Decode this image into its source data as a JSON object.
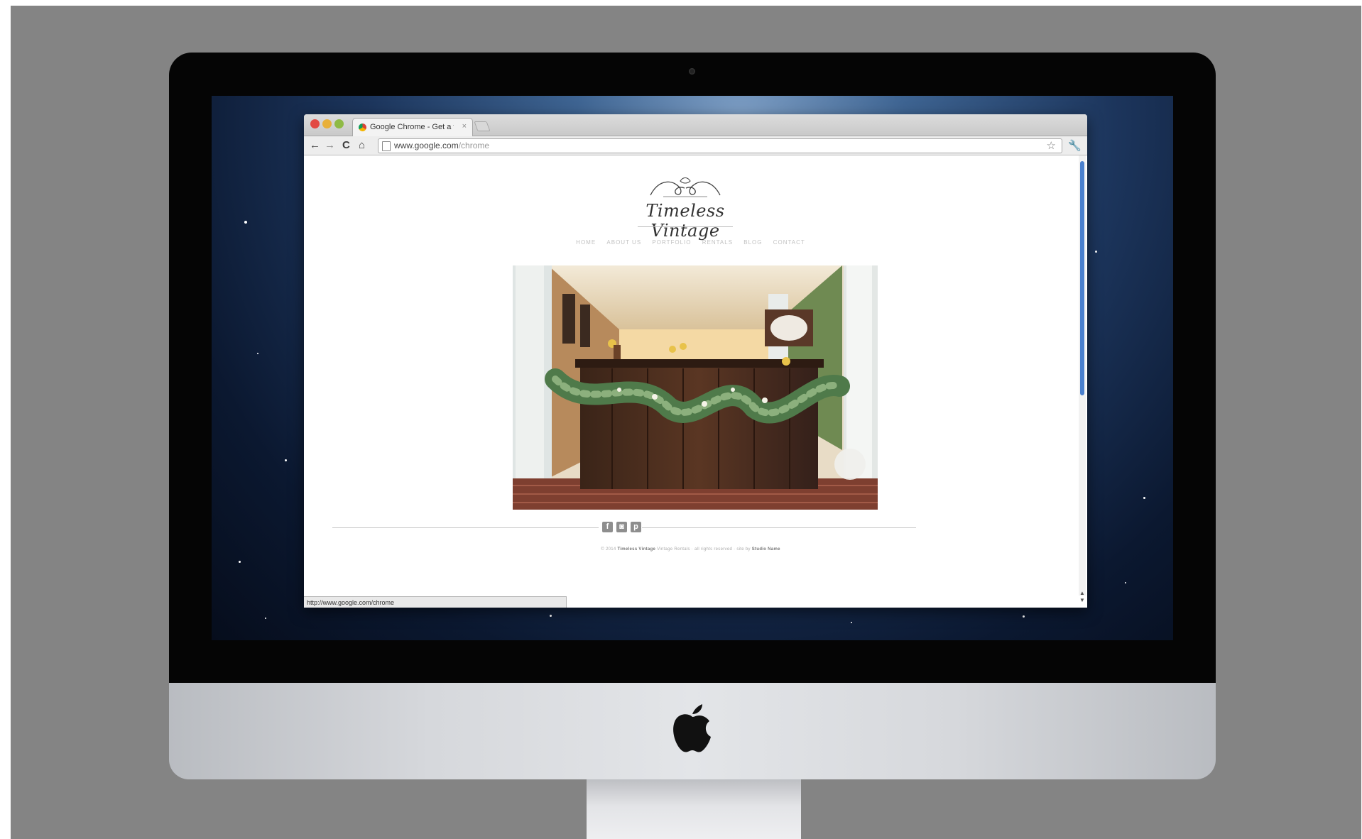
{
  "browser": {
    "tab_title": "Google Chrome - Get a fast...",
    "tab_close": "×",
    "url_host": "www.google.com",
    "url_path": "/chrome",
    "status_url": "http://www.google.com/chrome",
    "nav": {
      "back": "←",
      "forward": "→",
      "reload": "C",
      "home": "⌂"
    },
    "star": "☆",
    "wrench": "🔧"
  },
  "site": {
    "logo_text": "Timeless Vintage",
    "nav_items": [
      "HOME",
      "ABOUT US",
      "PORTFOLIO",
      "RENTALS",
      "BLOG",
      "CONTACT"
    ],
    "copyright_prefix": "© 2014",
    "copyright_brand": "Timeless Vintage",
    "copyright_middle": "Vintage Rentals · all rights reserved · site by",
    "copyright_credit": "Studio Name"
  },
  "social_icons": [
    "facebook-icon",
    "instagram-icon",
    "pinterest-icon"
  ],
  "colors": {
    "accent_scroll": "#4a80ce",
    "desktop_sky": "#1c355c",
    "backdrop": "#848484"
  }
}
